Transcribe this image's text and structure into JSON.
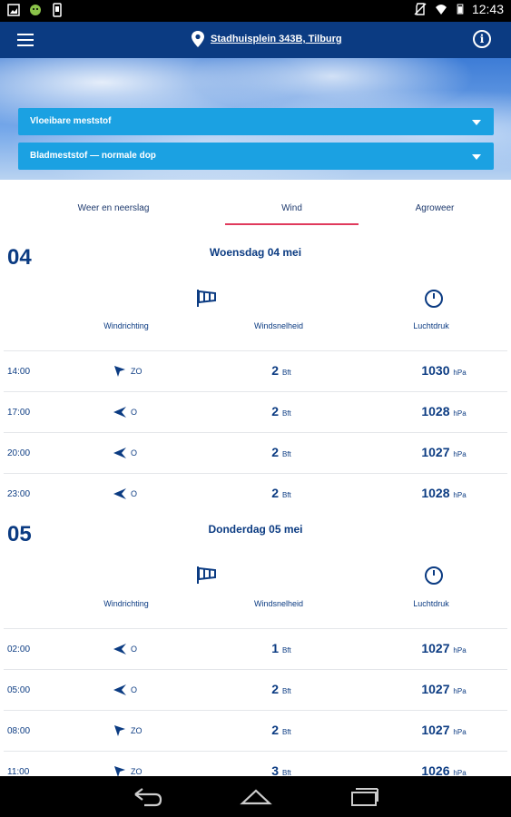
{
  "status_bar": {
    "time": "12:43"
  },
  "header": {
    "location": "Stadhuisplein 343B, Tilburg",
    "info_label": "i"
  },
  "selectors": [
    {
      "label": "Vloeibare meststof"
    },
    {
      "label": "Bladmeststof — normale dop"
    }
  ],
  "tabs": [
    {
      "label": "Weer en neerslag"
    },
    {
      "label": "Wind"
    },
    {
      "label": "Agroweer"
    }
  ],
  "columns": {
    "direction": "Windrichting",
    "speed": "Windsnelheid",
    "pressure": "Luchtdruk"
  },
  "units": {
    "speed": "Bft",
    "pressure": "hPa"
  },
  "days": [
    {
      "num": "04",
      "title": "Woensdag 04 mei",
      "rows": [
        {
          "time": "14:00",
          "dir": "ZO",
          "speed": "2",
          "pressure": "1030"
        },
        {
          "time": "17:00",
          "dir": "O",
          "speed": "2",
          "pressure": "1028"
        },
        {
          "time": "20:00",
          "dir": "O",
          "speed": "2",
          "pressure": "1027"
        },
        {
          "time": "23:00",
          "dir": "O",
          "speed": "2",
          "pressure": "1028"
        }
      ]
    },
    {
      "num": "05",
      "title": "Donderdag 05 mei",
      "rows": [
        {
          "time": "02:00",
          "dir": "O",
          "speed": "1",
          "pressure": "1027"
        },
        {
          "time": "05:00",
          "dir": "O",
          "speed": "2",
          "pressure": "1027"
        },
        {
          "time": "08:00",
          "dir": "ZO",
          "speed": "2",
          "pressure": "1027"
        },
        {
          "time": "11:00",
          "dir": "ZO",
          "speed": "3",
          "pressure": "1026"
        }
      ]
    }
  ],
  "colors": {
    "primary": "#0b3b82",
    "accent": "#1ba1e2",
    "tab_indicator": "#e03a5c"
  }
}
